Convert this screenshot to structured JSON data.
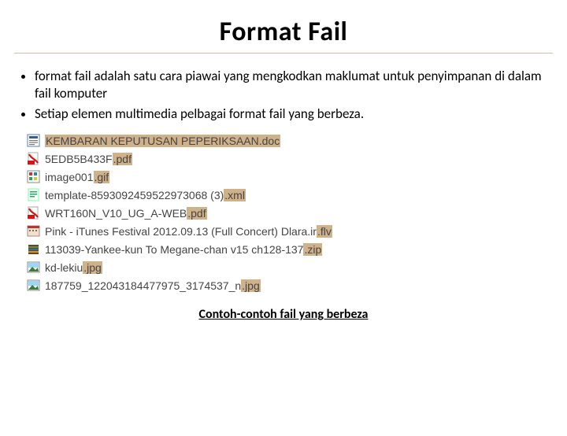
{
  "title": "Format Fail",
  "bullets": [
    "format fail adalah satu cara piawai yang mengkodkan maklumat untuk penyimpanan di dalam fail komputer",
    "Setiap elemen multimedia pelbagai format fail yang berbeza."
  ],
  "files": [
    {
      "icon": "doc",
      "base": "KEMBARAN KEPUTUSAN PEPERIKSAAN",
      "ext": ".doc"
    },
    {
      "icon": "pdf",
      "base": "5EDB5B433F",
      "ext": ".pdf"
    },
    {
      "icon": "gif",
      "base": "image001",
      "ext": ".gif"
    },
    {
      "icon": "xml",
      "base": "template-8593092459522973068 (3)",
      "ext": ".xml"
    },
    {
      "icon": "pdf",
      "base": "WRT160N_V10_UG_A-WEB",
      "ext": ".pdf"
    },
    {
      "icon": "flv",
      "base": "Pink - iTunes Festival 2012.09.13 (Full Concert) Dlara.ir",
      "ext": ".flv"
    },
    {
      "icon": "zip",
      "base": "113039-Yankee-kun To Megane-chan v15 ch128-137",
      "ext": ".zip"
    },
    {
      "icon": "jpg",
      "base": "kd-lekiu",
      "ext": ".jpg"
    },
    {
      "icon": "jpg",
      "base": "187759_122043184477975_3174537_n",
      "ext": ".jpg"
    }
  ],
  "caption": "Contoh-contoh fail yang berbeza"
}
